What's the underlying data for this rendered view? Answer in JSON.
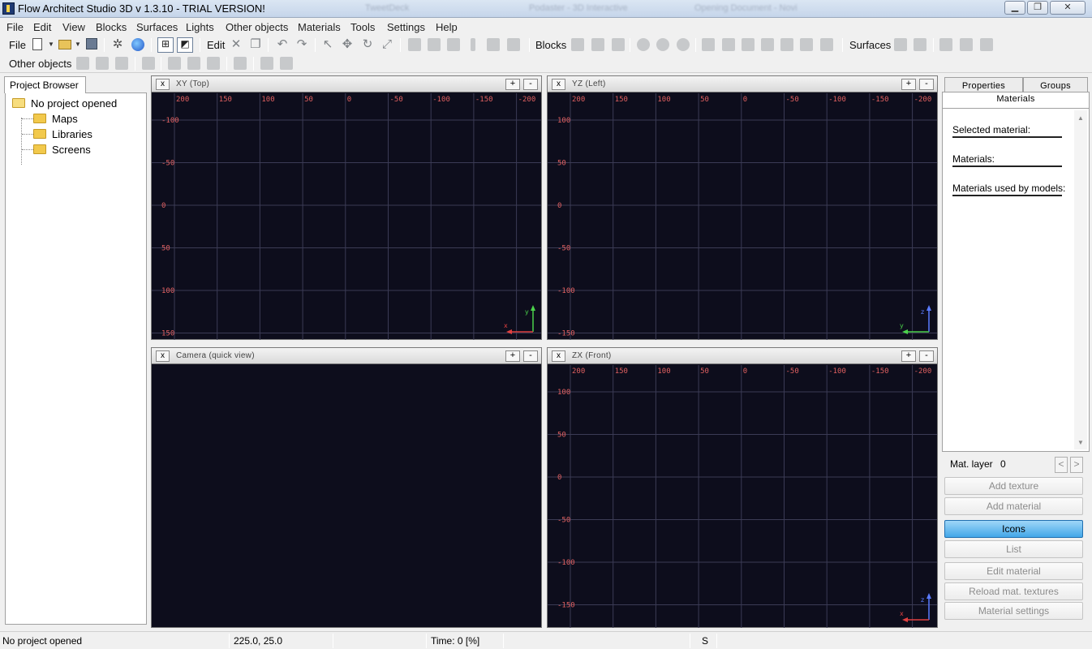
{
  "window": {
    "title": "Flow Architect Studio 3D v 1.3.10  - TRIAL VERSION!",
    "ghost_tabs": [
      "TweetDeck",
      "Podaster - 3D Interactive",
      "Opening Document - Novi"
    ]
  },
  "menu": [
    "File",
    "Edit",
    "View",
    "Blocks",
    "Surfaces",
    "Lights",
    "Other objects",
    "Materials",
    "Tools",
    "Settings",
    "Help"
  ],
  "toolbar": {
    "file_label": "File",
    "edit_label": "Edit",
    "blocks_label": "Blocks",
    "surfaces_label": "Surfaces",
    "other_objects_label": "Other objects"
  },
  "project_browser": {
    "tab": "Project Browser",
    "root": "No project opened",
    "children": [
      "Maps",
      "Libraries",
      "Screens"
    ]
  },
  "viewports": {
    "top": {
      "title": "XY (Top)",
      "x_labels": [
        "200",
        "150",
        "100",
        "50",
        "0",
        "-50",
        "-100",
        "-150",
        "-200"
      ],
      "y_labels": [
        "-100",
        "-50",
        "0",
        "50",
        "100",
        "150"
      ],
      "axis_a": "y",
      "axis_b": "x"
    },
    "left": {
      "title": "YZ (Left)",
      "x_labels": [
        "200",
        "150",
        "100",
        "50",
        "0",
        "-50",
        "-100",
        "-150",
        "-200"
      ],
      "y_labels": [
        "100",
        "50",
        "0",
        "-50",
        "-100",
        "-150"
      ],
      "axis_a": "z",
      "axis_b": "y"
    },
    "camera": {
      "title": "Camera (quick view)"
    },
    "front": {
      "title": "ZX (Front)",
      "x_labels": [
        "200",
        "150",
        "100",
        "50",
        "0",
        "-50",
        "-100",
        "-150",
        "-200"
      ],
      "y_labels": [
        "100",
        "50",
        "0",
        "-50",
        "-100",
        "-150"
      ],
      "axis_a": "z",
      "axis_b": "x"
    },
    "close_glyph": "x",
    "plus_glyph": "+",
    "minus_glyph": "-"
  },
  "right_panel": {
    "tabs": [
      "Properties",
      "Groups"
    ],
    "subtab": "Materials",
    "selected_material": "Selected material:",
    "materials": "Materials:",
    "materials_used": "Materials used by models:",
    "mat_layer_label": "Mat. layer",
    "mat_layer_value": "0",
    "buttons": [
      "Add texture",
      "Add material",
      "Icons",
      "List",
      "Edit material",
      "Reload mat. textures",
      "Material settings"
    ]
  },
  "status": {
    "project": "No project opened",
    "coords": "225.0, 25.0",
    "time": "Time: 0 [%]",
    "snap": "S"
  },
  "colors": {
    "viewport_bg": "#0d0d1c",
    "grid_line": "#3b3b55",
    "tick_label": "#e06060",
    "axis_green": "#4bd24b",
    "axis_red": "#e04040",
    "axis_blue": "#5a7bff",
    "primary_button": "#43a7e8"
  }
}
